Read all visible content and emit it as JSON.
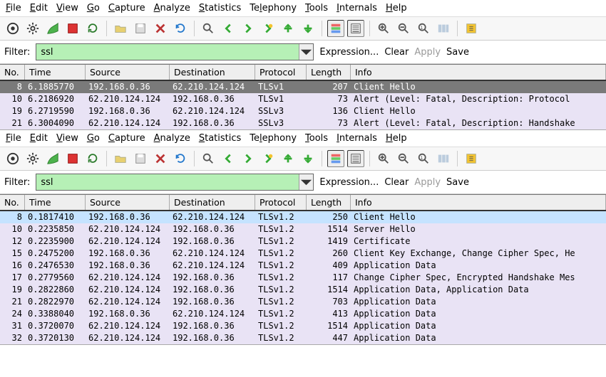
{
  "menus": [
    {
      "label": "File",
      "mn": "F"
    },
    {
      "label": "Edit",
      "mn": "E"
    },
    {
      "label": "View",
      "mn": "V"
    },
    {
      "label": "Go",
      "mn": "G"
    },
    {
      "label": "Capture",
      "mn": "C"
    },
    {
      "label": "Analyze",
      "mn": "A"
    },
    {
      "label": "Statistics",
      "mn": "S"
    },
    {
      "label": "Telephony",
      "mn": "l",
      "mnIndex": 2
    },
    {
      "label": "Tools",
      "mn": "T"
    },
    {
      "label": "Internals",
      "mn": "I"
    },
    {
      "label": "Help",
      "mn": "H"
    }
  ],
  "filter": {
    "label": "Filter:",
    "value": "ssl",
    "expression": "Expression...",
    "clear": "Clear",
    "apply": "Apply",
    "save": "Save"
  },
  "columns": {
    "no": "No.",
    "time": "Time",
    "source": "Source",
    "destination": "Destination",
    "protocol": "Protocol",
    "length": "Length",
    "info": "Info"
  },
  "pane1": {
    "rows": [
      {
        "no": "8",
        "time": "6.1885770",
        "src": "192.168.0.36",
        "dst": "62.210.124.124",
        "proto": "TLSv1",
        "len": "207",
        "info": "Client Hello",
        "sel": "dark"
      },
      {
        "no": "10",
        "time": "6.2186920",
        "src": "62.210.124.124",
        "dst": "192.168.0.36",
        "proto": "TLSv1",
        "len": "73",
        "info": "Alert (Level: Fatal, Description: Protocol",
        "cls": "vio"
      },
      {
        "no": "19",
        "time": "6.2719590",
        "src": "192.168.0.36",
        "dst": "62.210.124.124",
        "proto": "SSLv3",
        "len": "136",
        "info": "Client Hello",
        "cls": "vio"
      },
      {
        "no": "21",
        "time": "6.3004090",
        "src": "62.210.124.124",
        "dst": "192.168.0.36",
        "proto": "SSLv3",
        "len": "73",
        "info": "Alert (Level: Fatal, Description: Handshake",
        "cls": "vio"
      }
    ]
  },
  "pane2": {
    "rows": [
      {
        "no": "8",
        "time": "0.1817410",
        "src": "192.168.0.36",
        "dst": "62.210.124.124",
        "proto": "TLSv1.2",
        "len": "250",
        "info": "Client Hello",
        "sel": "light"
      },
      {
        "no": "10",
        "time": "0.2235850",
        "src": "62.210.124.124",
        "dst": "192.168.0.36",
        "proto": "TLSv1.2",
        "len": "1514",
        "info": "Server Hello",
        "cls": "vio"
      },
      {
        "no": "12",
        "time": "0.2235900",
        "src": "62.210.124.124",
        "dst": "192.168.0.36",
        "proto": "TLSv1.2",
        "len": "1419",
        "info": "Certificate",
        "cls": "vio"
      },
      {
        "no": "15",
        "time": "0.2475200",
        "src": "192.168.0.36",
        "dst": "62.210.124.124",
        "proto": "TLSv1.2",
        "len": "260",
        "info": "Client Key Exchange, Change Cipher Spec, He",
        "cls": "vio"
      },
      {
        "no": "16",
        "time": "0.2476530",
        "src": "192.168.0.36",
        "dst": "62.210.124.124",
        "proto": "TLSv1.2",
        "len": "409",
        "info": "Application Data",
        "cls": "vio"
      },
      {
        "no": "17",
        "time": "0.2779560",
        "src": "62.210.124.124",
        "dst": "192.168.0.36",
        "proto": "TLSv1.2",
        "len": "117",
        "info": "Change Cipher Spec, Encrypted Handshake Mes",
        "cls": "vio"
      },
      {
        "no": "19",
        "time": "0.2822860",
        "src": "62.210.124.124",
        "dst": "192.168.0.36",
        "proto": "TLSv1.2",
        "len": "1514",
        "info": "Application Data, Application Data",
        "cls": "vio"
      },
      {
        "no": "21",
        "time": "0.2822970",
        "src": "62.210.124.124",
        "dst": "192.168.0.36",
        "proto": "TLSv1.2",
        "len": "703",
        "info": "Application Data",
        "cls": "vio"
      },
      {
        "no": "24",
        "time": "0.3388040",
        "src": "192.168.0.36",
        "dst": "62.210.124.124",
        "proto": "TLSv1.2",
        "len": "413",
        "info": "Application Data",
        "cls": "vio"
      },
      {
        "no": "31",
        "time": "0.3720070",
        "src": "62.210.124.124",
        "dst": "192.168.0.36",
        "proto": "TLSv1.2",
        "len": "1514",
        "info": "Application Data",
        "cls": "vio"
      },
      {
        "no": "32",
        "time": "0.3720130",
        "src": "62.210.124.124",
        "dst": "192.168.0.36",
        "proto": "TLSv1.2",
        "len": "447",
        "info": "Application Data",
        "cls": "vio"
      }
    ]
  },
  "icons": {
    "list_ifaces": "list-interfaces-icon",
    "capture_options": "capture-options-icon",
    "start": "start-capture-icon",
    "stop": "stop-capture-icon",
    "restart": "restart-capture-icon",
    "open": "open-file-icon",
    "save": "save-file-icon",
    "close": "close-file-icon",
    "reload": "reload-icon",
    "find": "find-packet-icon",
    "back": "go-back-icon",
    "forward": "go-forward-icon",
    "jump": "go-to-packet-icon",
    "first": "go-first-icon",
    "last": "go-last-icon",
    "colorize": "colorize-icon",
    "autoscroll": "autoscroll-icon",
    "zoom_in": "zoom-in-icon",
    "zoom_out": "zoom-out-icon",
    "zoom_reset": "zoom-reset-icon",
    "resize_cols": "resize-columns-icon",
    "capture_filters": "capture-filters-icon"
  }
}
